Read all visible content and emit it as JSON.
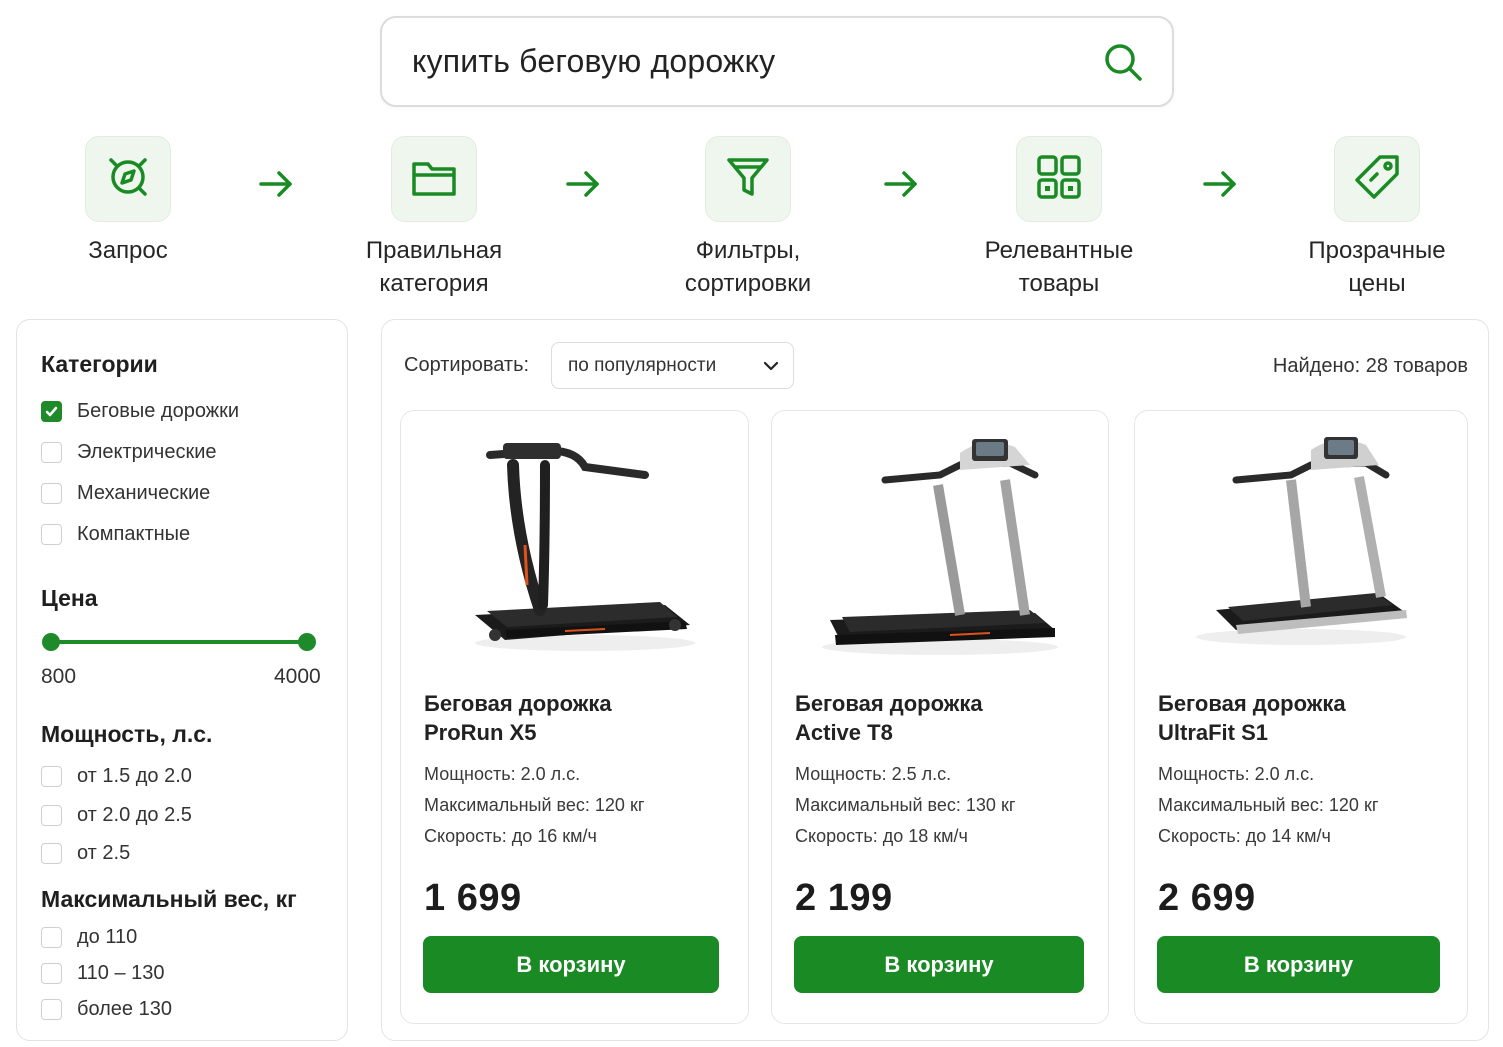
{
  "search": {
    "query": "купить беговую дорожку",
    "icon": "search-icon"
  },
  "steps": [
    {
      "label": "Запрос",
      "icon": "target-icon"
    },
    {
      "label": "Правильная категория",
      "icon": "folder-icon"
    },
    {
      "label": "Фильтры, сортировки",
      "icon": "filter-icon"
    },
    {
      "label": "Релевантные товары",
      "icon": "grid-icon"
    },
    {
      "label": "Прозрачные цены",
      "icon": "price-tag-icon"
    }
  ],
  "filters": {
    "categories_title": "Категории",
    "categories": [
      {
        "label": "Беговые дорожки",
        "checked": true
      },
      {
        "label": "Электрические",
        "checked": false
      },
      {
        "label": "Механические",
        "checked": false
      },
      {
        "label": "Компактные",
        "checked": false
      }
    ],
    "price_title": "Цена",
    "price_min": "800",
    "price_max": "4000",
    "power_title": "Мощность, л.с.",
    "power": [
      {
        "label": "от 1.5 до 2.0",
        "checked": false
      },
      {
        "label": "от 2.0 до 2.5",
        "checked": false
      },
      {
        "label": "от 2.5",
        "checked": false
      }
    ],
    "weight_title": "Максимальный вес, кг",
    "weight": [
      {
        "label": "до 110",
        "checked": false
      },
      {
        "label": "110 – 130",
        "checked": false
      },
      {
        "label": "более 130",
        "checked": false
      }
    ]
  },
  "toolbar": {
    "sort_label": "Сортировать:",
    "sort_value": "по популярности",
    "found": "Найдено: 28 товаров"
  },
  "products": [
    {
      "name_line1": "Беговая дорожка",
      "name_line2": "ProRun X5",
      "power": "Мощность: 2.0 л.с.",
      "max_weight": "Максимальный вес: 120 кг",
      "speed": "Скорость: до 16 км/ч",
      "price": "1 699",
      "button": "В корзину",
      "frame_color": "#2a2a2a",
      "accent": "#e0521b"
    },
    {
      "name_line1": "Беговая дорожка",
      "name_line2": "Active T8",
      "power": "Мощность: 2.5 л.с.",
      "max_weight": "Максимальный вес: 130 кг",
      "speed": "Скорость: до 18 км/ч",
      "price": "2 199",
      "button": "В корзину",
      "frame_color": "#9a9a9a",
      "accent": "#e0521b"
    },
    {
      "name_line1": "Беговая дорожка",
      "name_line2": "UltraFit S1",
      "power": "Мощность: 2.0 л.с.",
      "max_weight": "Максимальный вес: 120 кг",
      "speed": "Скорость: до 14 км/ч",
      "price": "2 699",
      "button": "В корзину",
      "frame_color": "#a8a8a8",
      "accent": "#bdbdbd"
    }
  ],
  "colors": {
    "accent": "#1a8a24",
    "tile_bg": "#eef6ee",
    "border": "#e3e3e3"
  }
}
